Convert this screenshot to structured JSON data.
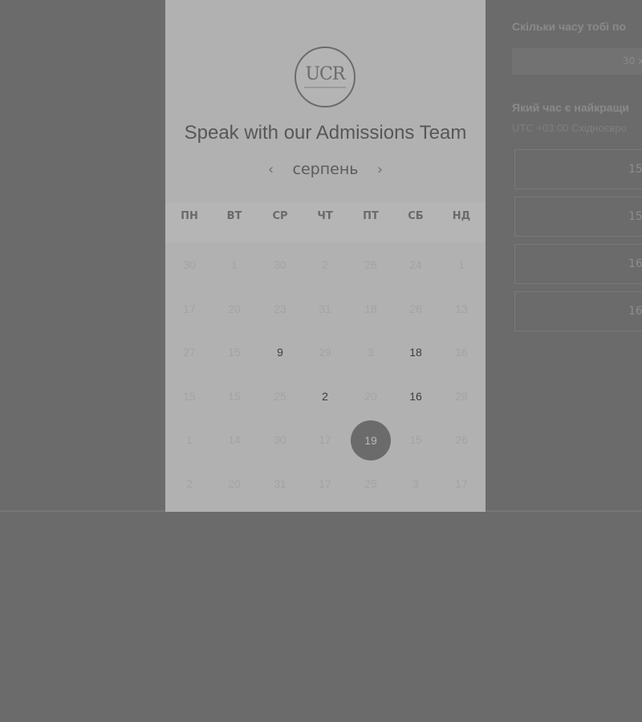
{
  "booking": {
    "logo_text": "UCR",
    "title": "Speak with our Admissions Team",
    "month": "серпень",
    "prev_icon": "‹",
    "next_icon": "›",
    "weekdays": [
      "ПН",
      "ВТ",
      "СР",
      "ЧТ",
      "ПТ",
      "СБ",
      "НД"
    ],
    "weeks": [
      [
        "30",
        "1",
        "30",
        "2",
        "26",
        "24",
        "1"
      ],
      [
        "17",
        "20",
        "23",
        "31",
        "18",
        "26",
        "13"
      ],
      [
        "27",
        "15",
        "9",
        "29",
        "3",
        "18",
        "16"
      ],
      [
        "15",
        "15",
        "25",
        "2",
        "20",
        "16",
        "28"
      ],
      [
        "1",
        "14",
        "30",
        "17",
        "19",
        "15",
        "26"
      ],
      [
        "2",
        "20",
        "31",
        "17",
        "25",
        "3",
        "17"
      ]
    ],
    "available_days": [
      "9",
      "18",
      "2",
      "16"
    ],
    "selected_day": "19"
  },
  "right_panel": {
    "duration_question": "Скільки часу тобі по",
    "duration_value": "30 х",
    "time_question": "Який час є найкращи",
    "timezone": "UTC +03:00 Східноєвро",
    "slots": [
      "15",
      "15",
      "16",
      "16"
    ]
  }
}
